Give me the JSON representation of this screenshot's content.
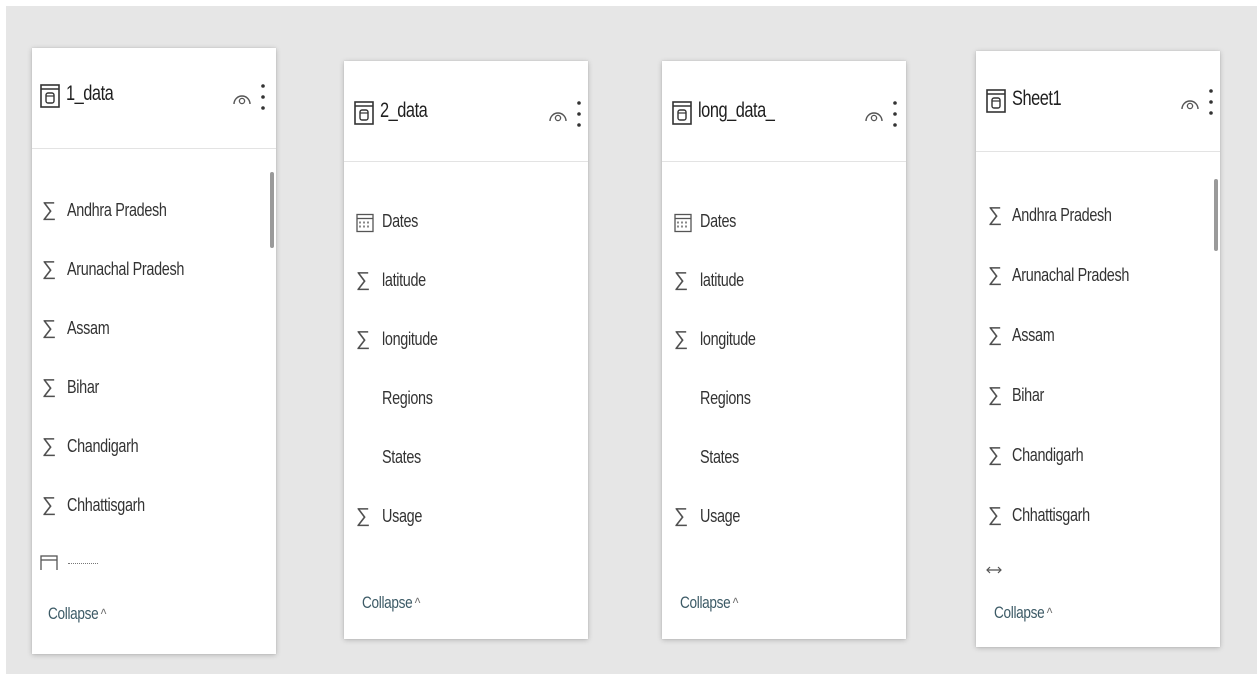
{
  "tables": [
    {
      "title": "1_data",
      "fields": [
        {
          "label": "Andhra Pradesh",
          "icon": "sigma-icon"
        },
        {
          "label": "Arunachal Pradesh",
          "icon": "sigma-icon"
        },
        {
          "label": "Assam",
          "icon": "sigma-icon"
        },
        {
          "label": "Bihar",
          "icon": "sigma-icon"
        },
        {
          "label": "Chandigarh",
          "icon": "sigma-icon"
        },
        {
          "label": "Chhattisgarh",
          "icon": "sigma-icon"
        }
      ],
      "partial_field": {
        "icon": "calendar-icon"
      },
      "collapse_label": "Collapse"
    },
    {
      "title": "2_data",
      "fields": [
        {
          "label": "Dates",
          "icon": "calendar-icon"
        },
        {
          "label": "latitude",
          "icon": "sigma-icon"
        },
        {
          "label": "longitude",
          "icon": "sigma-icon"
        },
        {
          "label": "Regions",
          "icon": ""
        },
        {
          "label": "States",
          "icon": ""
        },
        {
          "label": "Usage",
          "icon": "sigma-icon"
        }
      ],
      "collapse_label": "Collapse"
    },
    {
      "title": "long_data_",
      "fields": [
        {
          "label": "Dates",
          "icon": "calendar-icon"
        },
        {
          "label": "latitude",
          "icon": "sigma-icon"
        },
        {
          "label": "longitude",
          "icon": "sigma-icon"
        },
        {
          "label": "Regions",
          "icon": ""
        },
        {
          "label": "States",
          "icon": ""
        },
        {
          "label": "Usage",
          "icon": "sigma-icon"
        }
      ],
      "collapse_label": "Collapse"
    },
    {
      "title": "Sheet1",
      "fields": [
        {
          "label": "Andhra Pradesh",
          "icon": "sigma-icon"
        },
        {
          "label": "Arunachal Pradesh",
          "icon": "sigma-icon"
        },
        {
          "label": "Assam",
          "icon": "sigma-icon"
        },
        {
          "label": "Bihar",
          "icon": "sigma-icon"
        },
        {
          "label": "Chandigarh",
          "icon": "sigma-icon"
        },
        {
          "label": "Chhattisgarh",
          "icon": "sigma-icon"
        }
      ],
      "partial_field": {
        "icon": "arrows-horizontal-icon"
      },
      "collapse_label": "Collapse"
    }
  ],
  "colors": {
    "canvas_background": "#e6e6e6",
    "card_background": "#ffffff",
    "collapse_link": "#3c5a66"
  }
}
